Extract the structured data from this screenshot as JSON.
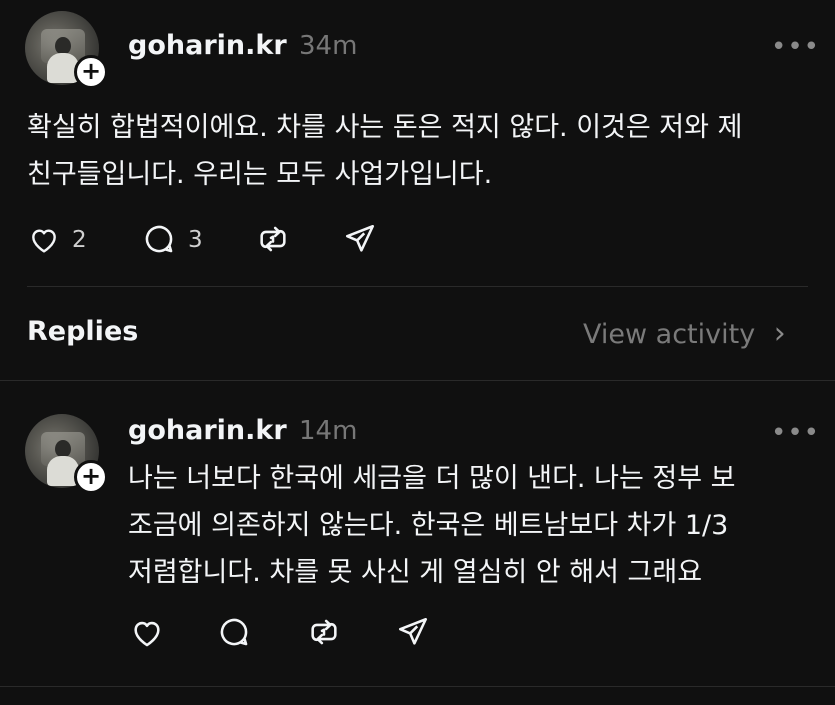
{
  "post": {
    "username": "goharin.kr",
    "time": "34m",
    "more": "•••",
    "text_line1": "확실히 합법적이에요. 차를 사는 돈은 적지 않다. 이것은 저와 제",
    "text_line2": "친구들입니다. 우리는 모두 사업가입니다.",
    "like_count": "2",
    "reply_count": "3",
    "icons": [
      "heart-icon",
      "comment-icon",
      "repost-icon",
      "share-icon"
    ]
  },
  "section": {
    "replies_label": "Replies",
    "view_activity_label": "View activity",
    "chevron": "›"
  },
  "reply": {
    "username": "goharin.kr",
    "time": "14m",
    "more": "•••",
    "text_line1": "나는 너보다 한국에 세금을 더 많이 낸다. 나는 정부 보",
    "text_line2": "조금에 의존하지 않는다. 한국은 베트남보다 차가 1/3",
    "text_line3": "저렴합니다. 차를 못 사신 게 열심히 안 해서 그래요",
    "icons": [
      "heart-icon",
      "comment-icon",
      "repost-icon",
      "share-icon"
    ]
  },
  "colors": {
    "background": "#101010",
    "text": "#f3f5f7",
    "secondary": "#777777",
    "divider": "#2a2a2a"
  }
}
